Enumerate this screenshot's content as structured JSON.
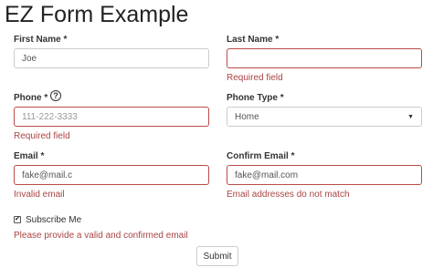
{
  "page": {
    "title": "EZ Form Example"
  },
  "first_name": {
    "label": "First Name *",
    "value": "Joe",
    "placeholder": ""
  },
  "last_name": {
    "label": "Last Name *",
    "value": "",
    "placeholder": "",
    "error": "Required field"
  },
  "phone": {
    "label": "Phone *",
    "help_symbol": "?",
    "value": "",
    "placeholder": "111-222-3333",
    "error": "Required field"
  },
  "phone_type": {
    "label": "Phone Type *",
    "selected": "Home"
  },
  "email": {
    "label": "Email *",
    "value": "fake@mail.c",
    "error": "Invalid email"
  },
  "confirm_email": {
    "label": "Confirm Email *",
    "value": "fake@mail.com",
    "error": "Email addresses do not match"
  },
  "subscribe": {
    "label": "Subscribe Me",
    "checked": true,
    "error": "Please provide a valid and confirmed email"
  },
  "submit": {
    "label": "Submit"
  },
  "colors": {
    "error": "#a94442",
    "error_border": "#b94a48",
    "border": "#cccccc"
  },
  "icons": {
    "help": "question-circle-icon",
    "caret": "caret-down-icon",
    "check": "checkmark-icon"
  }
}
